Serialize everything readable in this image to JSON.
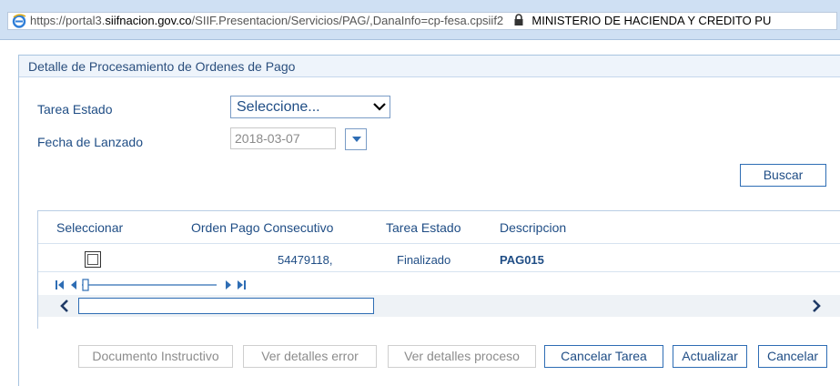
{
  "browser": {
    "url_prefix": "https://portal3.",
    "url_domain": "siifnacion.gov.co",
    "url_path": "/SIIF.Presentacion/Servicios/PAG/,DanaInfo=cp-fesa.cpsiif2",
    "site_owner": "MINISTERIO DE HACIENDA Y CREDITO PU"
  },
  "panel": {
    "title": "Detalle de Procesamiento de Ordenes de Pago"
  },
  "form": {
    "tarea_estado_label": "Tarea Estado",
    "tarea_estado_value": "Seleccione...",
    "fecha_label": "Fecha de Lanzado",
    "fecha_value": "2018-03-07",
    "buscar_label": "Buscar"
  },
  "grid": {
    "columns": [
      "Seleccionar",
      "Orden Pago Consecutivo",
      "Tarea Estado",
      "Descripcion"
    ],
    "rows": [
      {
        "orden": "54479118,",
        "estado": "Finalizado",
        "descripcion": "PAG015"
      }
    ]
  },
  "buttons": {
    "documento": "Documento Instructivo",
    "ver_error": "Ver detalles error",
    "ver_proceso": "Ver detalles proceso",
    "cancelar_tarea": "Cancelar Tarea",
    "actualizar": "Actualizar",
    "cancelar": "Cancelar"
  },
  "icons": {
    "browser": "ie-icon",
    "lock": "lock-icon",
    "dropdown": "chevron-down-icon",
    "calendar": "calendar-dropdown-icon",
    "pager": [
      "first-page-icon",
      "prev-page-icon",
      "next-page-icon",
      "last-page-icon"
    ],
    "scroll": [
      "scroll-left-icon",
      "scroll-right-icon"
    ]
  },
  "colors": {
    "accent": "#1f4d85",
    "border_active": "#2e6db4",
    "titlebar": "#cfe0f3"
  }
}
